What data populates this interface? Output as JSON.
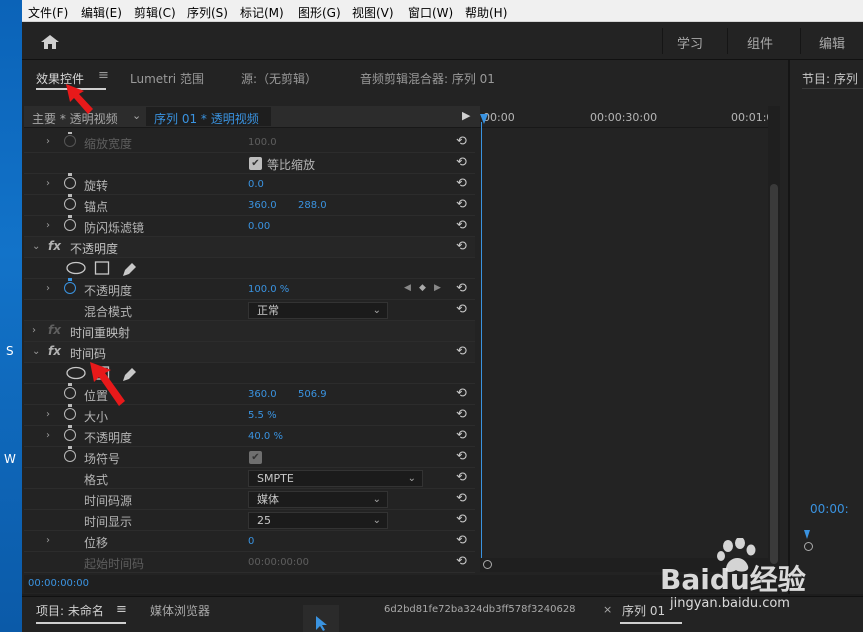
{
  "desktop": {
    "char_s": "S",
    "char_w": "W"
  },
  "menu": [
    "文件(F)",
    "编辑(E)",
    "剪辑(C)",
    "序列(S)",
    "标记(M)",
    "图形(G)",
    "视图(V)",
    "窗口(W)",
    "帮助(H)"
  ],
  "workspaces": [
    "学习",
    "组件",
    "编辑"
  ],
  "panel_tabs": {
    "effect_controls": "效果控件",
    "lumetri": "Lumetri 范围",
    "source": "源:（无剪辑）",
    "mixer": "音频剪辑混合器: 序列 01"
  },
  "seq": {
    "master": "主要 * 透明视频",
    "sequence": "序列 01 * 透明视频"
  },
  "timeline": {
    "t0": "00:00",
    "t1": "00:00:30:00",
    "t2": "00:01:0"
  },
  "rows": [
    {
      "label": "缩放宽度",
      "v1": "100.0"
    },
    {
      "label": "等比缩放"
    },
    {
      "label": "旋转",
      "v1": "0.0"
    },
    {
      "label": "锚点",
      "v1": "360.0",
      "v2": "288.0"
    },
    {
      "label": "防闪烁滤镜",
      "v1": "0.00"
    },
    {
      "label": "不透明度"
    },
    {
      "label": "mask-tools"
    },
    {
      "label": "不透明度",
      "v1": "100.0 %"
    },
    {
      "label": "混合模式",
      "dd": "正常"
    },
    {
      "label": "时间重映射"
    },
    {
      "label": "时间码"
    },
    {
      "label": "mask-tools"
    },
    {
      "label": "位置",
      "v1": "360.0",
      "v2": "506.9"
    },
    {
      "label": "大小",
      "v1": "5.5 %"
    },
    {
      "label": "不透明度",
      "v1": "40.0 %"
    },
    {
      "label": "场符号"
    },
    {
      "label": "格式",
      "dd": "SMPTE"
    },
    {
      "label": "时间码源",
      "dd": "媒体"
    },
    {
      "label": "时间显示",
      "dd": "25"
    },
    {
      "label": "位移",
      "v1": "0"
    },
    {
      "label": "起始时间码",
      "v1": "00:00:00:00"
    }
  ],
  "current_timecode": "00:00:00:00",
  "program": {
    "title": "节目: 序列",
    "timecode": "00:00:"
  },
  "project": {
    "tab": "项目: 未命名",
    "media_browser": "媒体浏览器",
    "clip_hash": "6d2bd81fe72ba324db3ff578f3240628",
    "seq_tab": "序列 01",
    "close": "×"
  },
  "watermark": {
    "brand": "Baidu经验",
    "url": "jingyan.baidu.com"
  },
  "colors": {
    "accent": "#3a93e0",
    "bg": "#232323",
    "menubar": "#f0f0f0",
    "arrow": "#e8191a"
  }
}
